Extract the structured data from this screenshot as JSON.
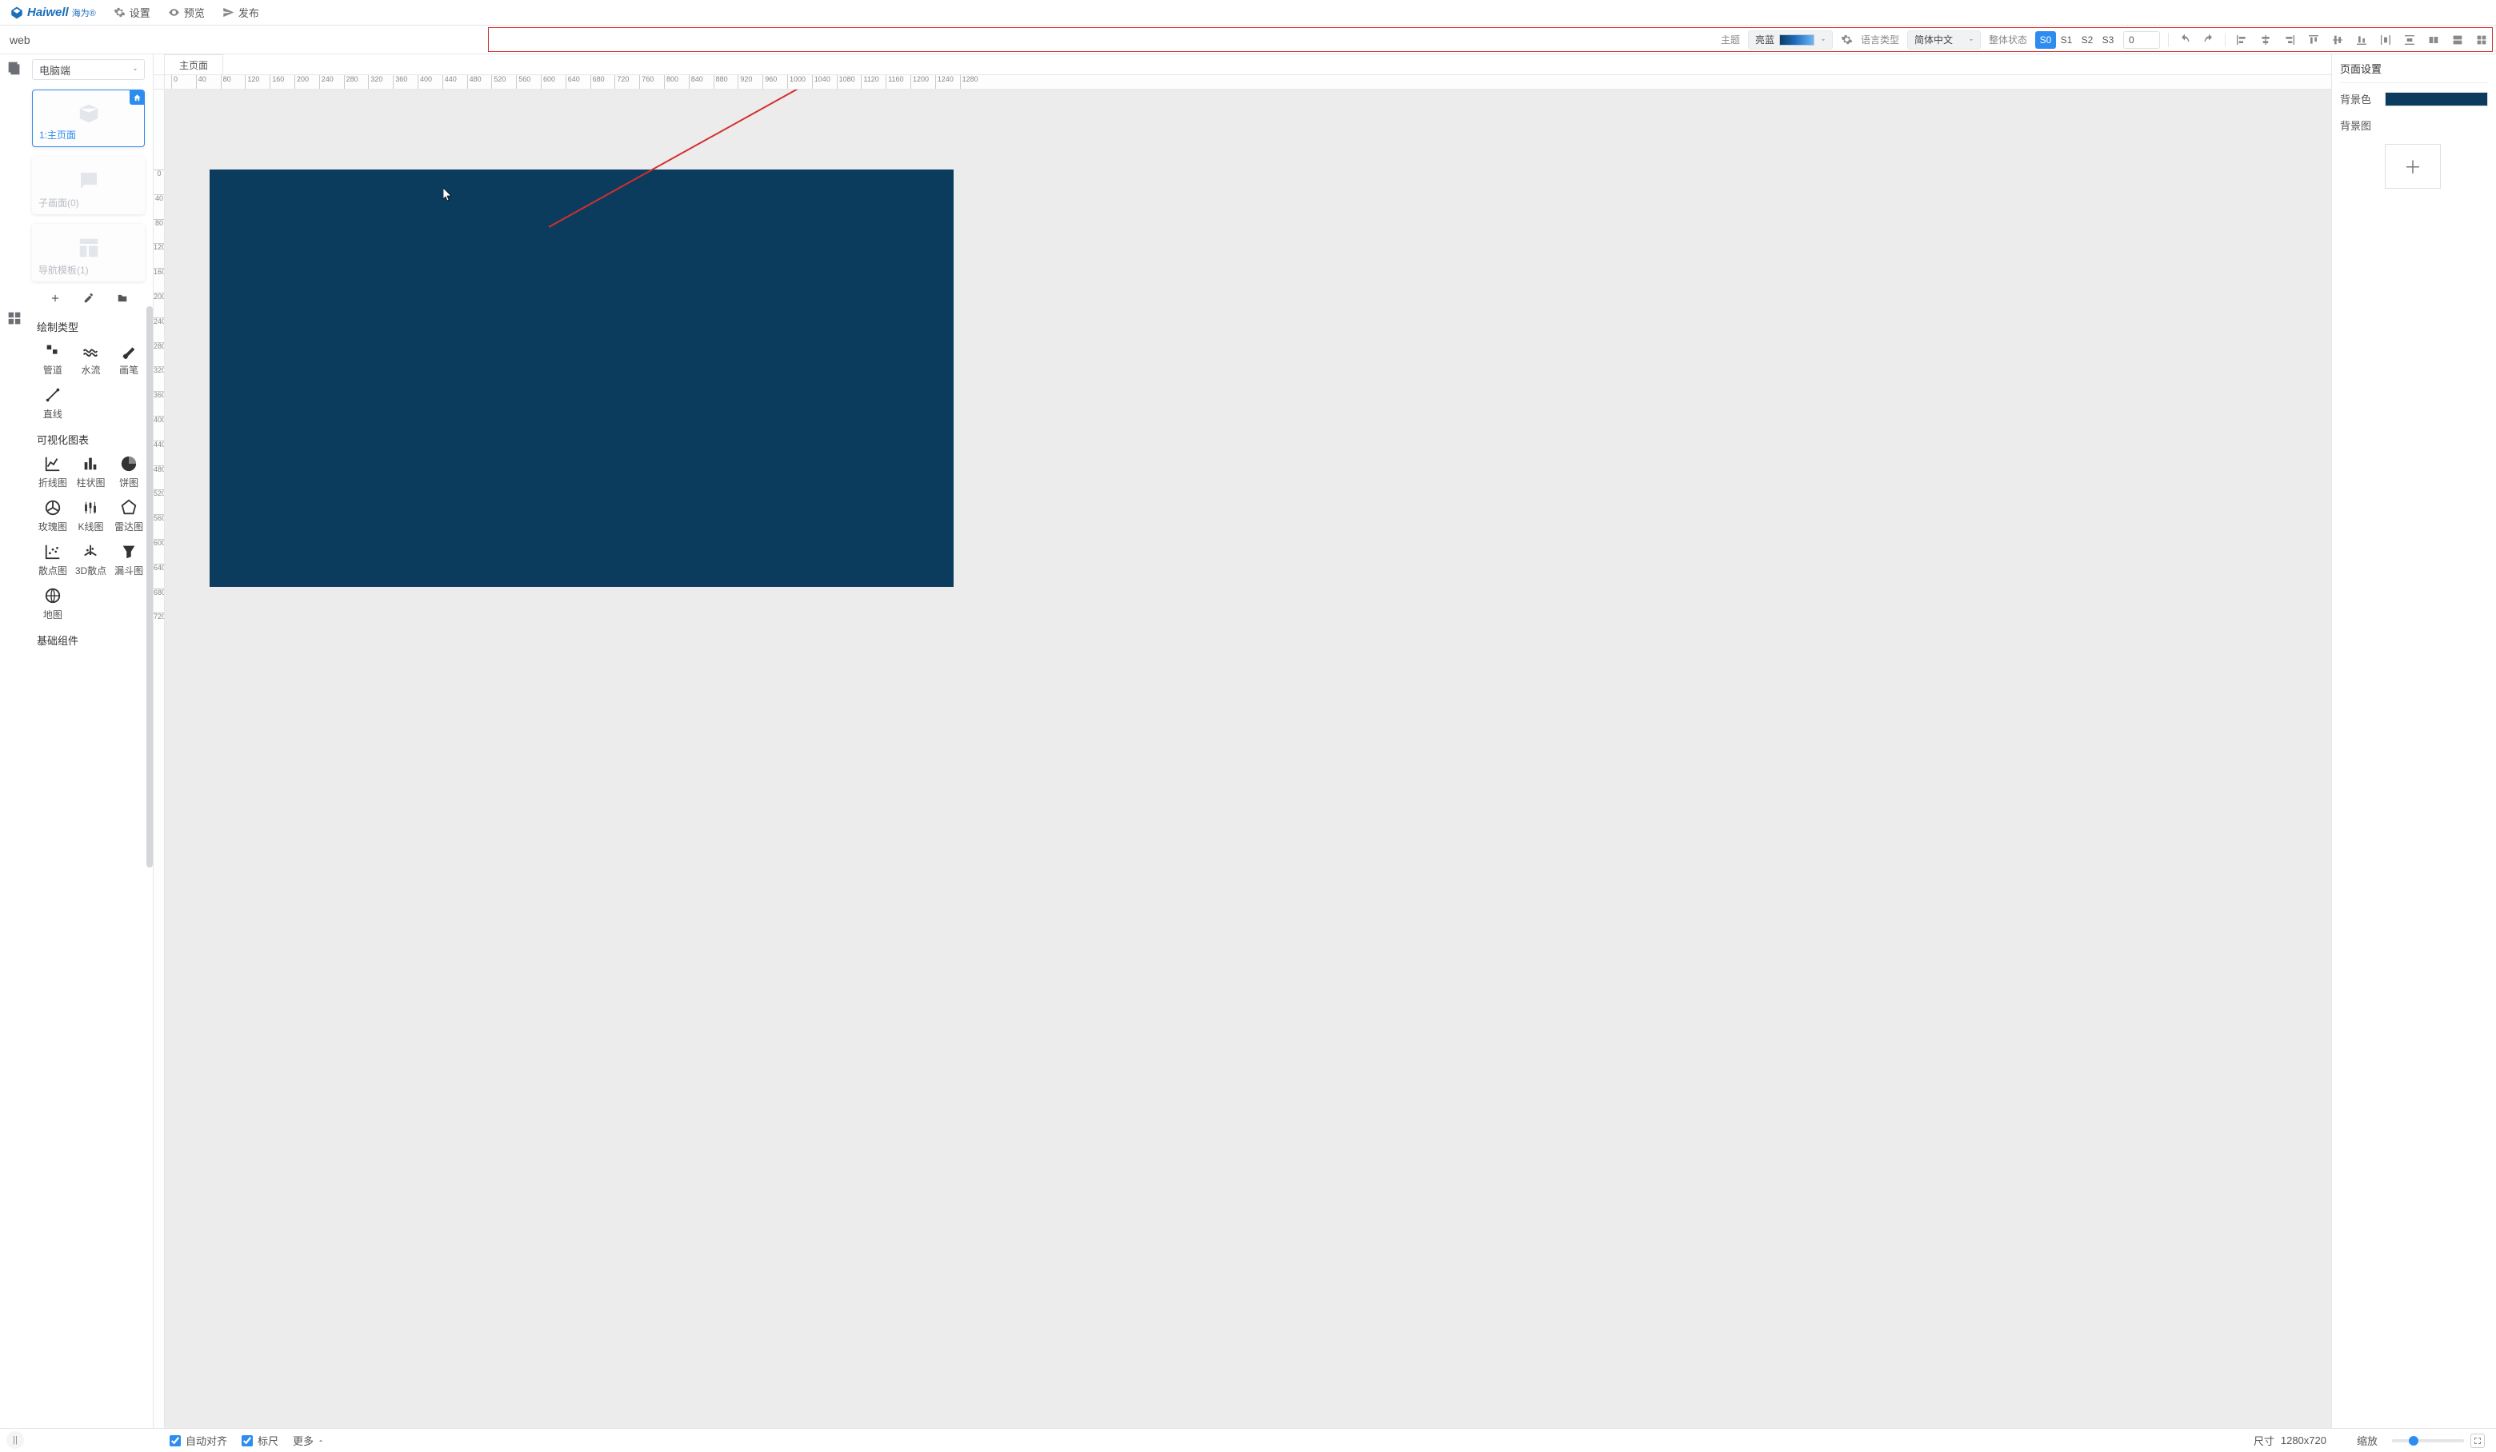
{
  "brand": {
    "name": "Haiwell",
    "sub": "海为®"
  },
  "menubar": [
    {
      "icon": "gear",
      "label": "设置"
    },
    {
      "icon": "eye",
      "label": "预览"
    },
    {
      "icon": "send",
      "label": "发布"
    }
  ],
  "project_name": "web",
  "toolbar": {
    "theme_label": "主题",
    "theme_value": "亮蓝",
    "lang_label": "语言类型",
    "lang_value": "简体中文",
    "state_label": "整体状态",
    "states": [
      "S0",
      "S1",
      "S2",
      "S3"
    ],
    "state_active_index": 0,
    "state_input": "0"
  },
  "left": {
    "device_value": "电脑端",
    "pages": [
      {
        "label": "1:主页面",
        "active": true,
        "home": true,
        "icon": "box"
      },
      {
        "label": "子画面(0)",
        "active": false,
        "icon": "dialog"
      },
      {
        "label": "导航模板(1)",
        "active": false,
        "icon": "layout"
      }
    ],
    "sections": {
      "draw_title": "绘制类型",
      "draw_items": [
        {
          "icon": "pipe",
          "label": "管道"
        },
        {
          "icon": "flow",
          "label": "水流"
        },
        {
          "icon": "brush",
          "label": "画笔"
        },
        {
          "icon": "line",
          "label": "直线"
        }
      ],
      "chart_title": "可视化图表",
      "chart_items": [
        {
          "icon": "linechart",
          "label": "折线图"
        },
        {
          "icon": "barchart",
          "label": "柱状图"
        },
        {
          "icon": "pie",
          "label": "饼图"
        },
        {
          "icon": "rose",
          "label": "玫瑰图"
        },
        {
          "icon": "candle",
          "label": "K线图"
        },
        {
          "icon": "radar",
          "label": "雷达图"
        },
        {
          "icon": "scatter",
          "label": "散点图"
        },
        {
          "icon": "scatter3d",
          "label": "3D散点"
        },
        {
          "icon": "funnel",
          "label": "漏斗图"
        },
        {
          "icon": "globe",
          "label": "地图"
        }
      ],
      "basic_title": "基础组件"
    }
  },
  "editor_tab": "主页面",
  "ruler_h": [
    0,
    40,
    80,
    120,
    160,
    200,
    240,
    280,
    320,
    360,
    400,
    440,
    480,
    520,
    560,
    600,
    640,
    680,
    720,
    760,
    800,
    840,
    880,
    920,
    960,
    1000,
    1040,
    1080,
    1120,
    1160,
    1200,
    1240,
    1280
  ],
  "ruler_v": [
    0,
    40,
    80,
    120,
    160,
    200,
    240,
    280,
    320,
    360,
    400,
    440,
    480,
    520,
    560,
    600,
    640,
    680,
    720
  ],
  "rightpanel": {
    "title": "页面设置",
    "bgcolor_label": "背景色",
    "bgimg_label": "背景图",
    "add_symbol": "＋"
  },
  "statusbar": {
    "autoalign": "自动对齐",
    "ruler": "标尺",
    "more": "更多",
    "size_label": "尺寸",
    "size_value": "1280x720",
    "zoom_label": "缩放",
    "zoom_percent": 30
  }
}
